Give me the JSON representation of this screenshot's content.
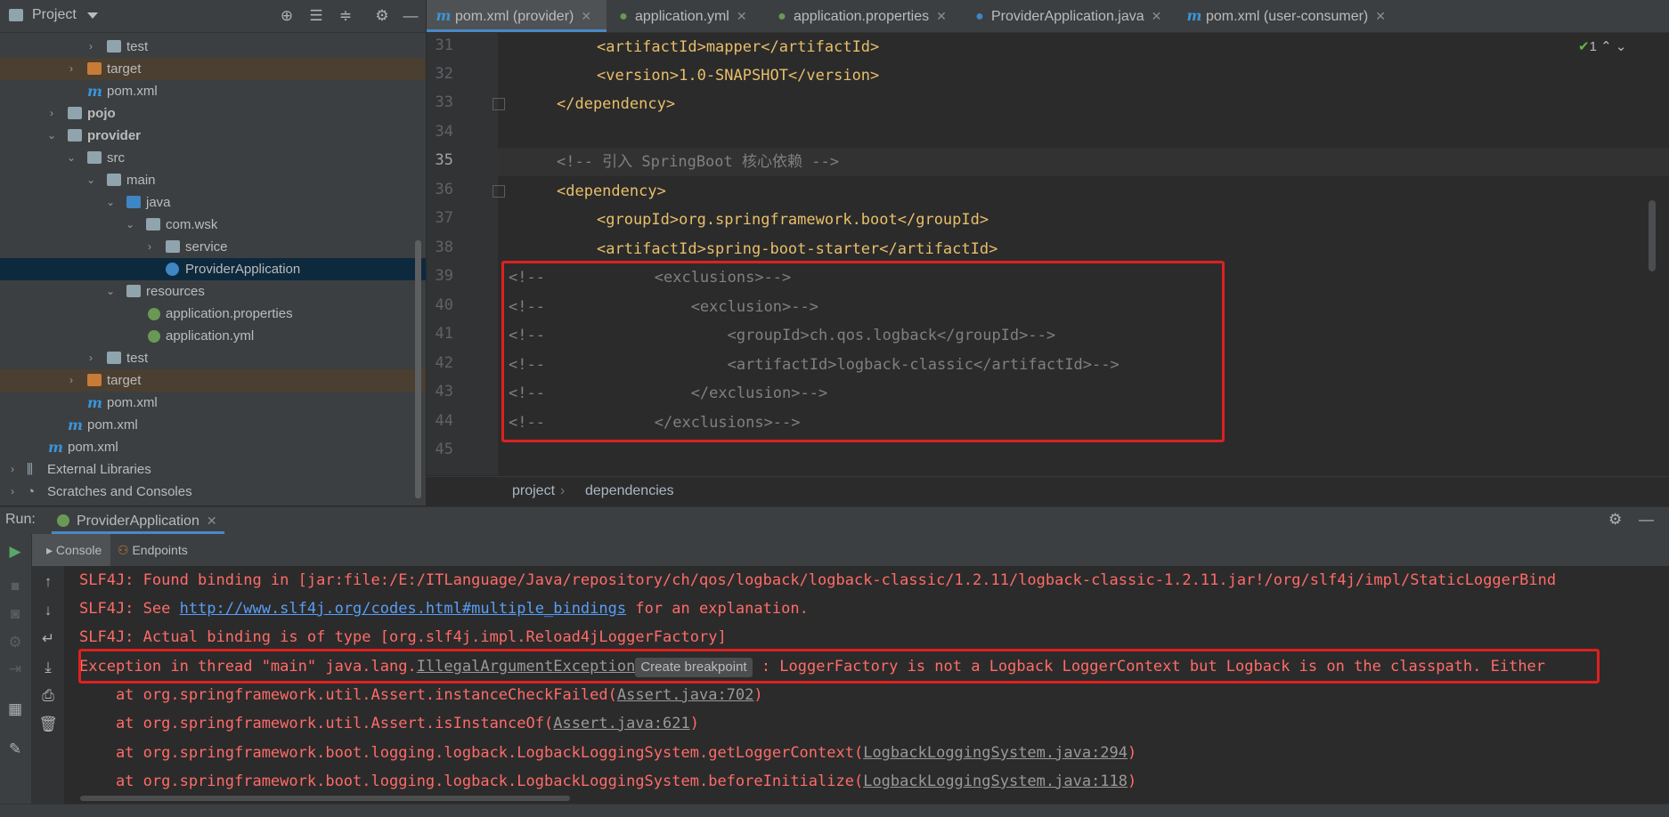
{
  "project_panel": {
    "title": "Project",
    "toolbar_icons": [
      "locate-icon",
      "expand-all-icon",
      "collapse-all-icon",
      "gear-icon",
      "minimize-icon"
    ],
    "tree": [
      {
        "label": "test",
        "type": "folder"
      },
      {
        "label": "target",
        "type": "folder-excluded"
      },
      {
        "label": "pom.xml",
        "type": "maven"
      },
      {
        "label": "pojo",
        "type": "module"
      },
      {
        "label": "provider",
        "type": "module"
      },
      {
        "label": "src",
        "type": "folder"
      },
      {
        "label": "main",
        "type": "folder"
      },
      {
        "label": "java",
        "type": "source-folder"
      },
      {
        "label": "com.wsk",
        "type": "package"
      },
      {
        "label": "service",
        "type": "package"
      },
      {
        "label": "ProviderApplication",
        "type": "class"
      },
      {
        "label": "resources",
        "type": "resources"
      },
      {
        "label": "application.properties",
        "type": "spring-config"
      },
      {
        "label": "application.yml",
        "type": "spring-config"
      },
      {
        "label": "test",
        "type": "folder"
      },
      {
        "label": "target",
        "type": "folder-excluded"
      },
      {
        "label": "pom.xml",
        "type": "maven"
      },
      {
        "label": "pom.xml",
        "type": "maven"
      },
      {
        "label": "pom.xml",
        "type": "maven"
      },
      {
        "label": "External Libraries",
        "type": "libraries"
      },
      {
        "label": "Scratches and Consoles",
        "type": "scratches"
      }
    ]
  },
  "tabs": [
    {
      "label": "pom.xml (provider)",
      "icon": "maven-icon",
      "active": true
    },
    {
      "label": "application.yml",
      "icon": "spring-icon"
    },
    {
      "label": "application.properties",
      "icon": "spring-icon"
    },
    {
      "label": "ProviderApplication.java",
      "icon": "class-icon"
    },
    {
      "label": "pom.xml (user-consumer)",
      "icon": "maven-icon"
    }
  ],
  "editor": {
    "inspection_count": "1",
    "lines": [
      {
        "n": "31",
        "text": "<artifactId>mapper</artifactId>"
      },
      {
        "n": "32",
        "text": "<version>1.0-SNAPSHOT</version>"
      },
      {
        "n": "33",
        "text": "</dependency>"
      },
      {
        "n": "34",
        "text": ""
      },
      {
        "n": "35",
        "text": "<!-- 引入 SpringBoot 核心依赖 -->"
      },
      {
        "n": "36",
        "text": "<dependency>"
      },
      {
        "n": "37",
        "text": "<groupId>org.springframework.boot</groupId>"
      },
      {
        "n": "38",
        "text": "<artifactId>spring-boot-starter</artifactId>"
      },
      {
        "n": "39",
        "text": "<!--            <exclusions>-->"
      },
      {
        "n": "40",
        "text": "<!--                <exclusion>-->"
      },
      {
        "n": "41",
        "text": "<!--                    <groupId>ch.qos.logback</groupId>-->"
      },
      {
        "n": "42",
        "text": "<!--                    <artifactId>logback-classic</artifactId>-->"
      },
      {
        "n": "43",
        "text": "<!--                </exclusion>-->"
      },
      {
        "n": "44",
        "text": "<!--            </exclusions>-->"
      },
      {
        "n": "45",
        "text": ""
      }
    ]
  },
  "breadcrumb": [
    "project",
    "dependencies"
  ],
  "run_panel": {
    "label": "Run:",
    "tab": "ProviderApplication",
    "subtabs": [
      "Console",
      "Endpoints"
    ],
    "console": [
      "SLF4J: Found binding in [jar:file:/E:/ITLanguage/Java/repository/ch/qos/logback/logback-classic/1.2.11/logback-classic-1.2.11.jar!/org/slf4j/impl/StaticLoggerBind",
      "SLF4J: See ",
      "http://www.slf4j.org/codes.html#multiple_bindings",
      " for an explanation.",
      "SLF4J: Actual binding is of type [org.slf4j.impl.Reload4jLoggerFactory]",
      "Exception in thread \"main\" java.lang.",
      "IllegalArgumentException",
      "Create breakpoint",
      " : LoggerFactory is not a Logback LoggerContext but Logback is on the classpath. Either",
      "    at org.springframework.util.Assert.instanceCheckFailed(",
      "Assert.java:702",
      ")",
      "    at org.springframework.util.Assert.isInstanceOf(",
      "Assert.java:621",
      "    at org.springframework.boot.logging.logback.LogbackLoggingSystem.getLoggerContext(",
      "LogbackLoggingSystem.java:294",
      "    at org.springframework.boot.logging.logback.LogbackLoggingSystem.beforeInitialize(",
      "LogbackLoggingSystem.java:118"
    ]
  },
  "colors": {
    "highlight_box": "#e02020",
    "accent": "#4a88c7",
    "error_text": "#ff6b68"
  }
}
